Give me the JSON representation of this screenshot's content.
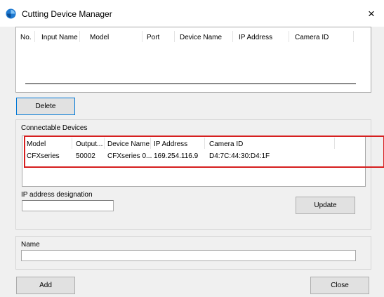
{
  "window": {
    "title": "Cutting Device Manager",
    "close_glyph": "×",
    "icon": "app-logo-icon"
  },
  "input_list": {
    "columns": [
      "No.",
      "Input Name",
      "Model",
      "Port",
      "Device Name",
      "IP Address",
      "Camera ID"
    ],
    "rows": []
  },
  "buttons": {
    "delete": "Delete",
    "update": "Update",
    "add": "Add",
    "close": "Close"
  },
  "connectable": {
    "group_label": "Connectable Devices",
    "columns": [
      "Model",
      "Output...",
      "Device Name",
      "IP Address",
      "Camera ID"
    ],
    "rows": [
      {
        "model": "CFXseries",
        "output": "50002",
        "device_name": "CFXseries 0...",
        "ip": "169.254.116.9",
        "camera_id": "D4:7C:44:30:D4:1F"
      }
    ]
  },
  "ip_designation": {
    "label": "IP address designation",
    "value": ""
  },
  "name": {
    "label": "Name",
    "value": ""
  },
  "colors": {
    "highlight_box": "#d61f1f",
    "focus_border": "#0078d7",
    "button_bg": "#e1e1e1",
    "window_bg": "#f0f0f0"
  }
}
